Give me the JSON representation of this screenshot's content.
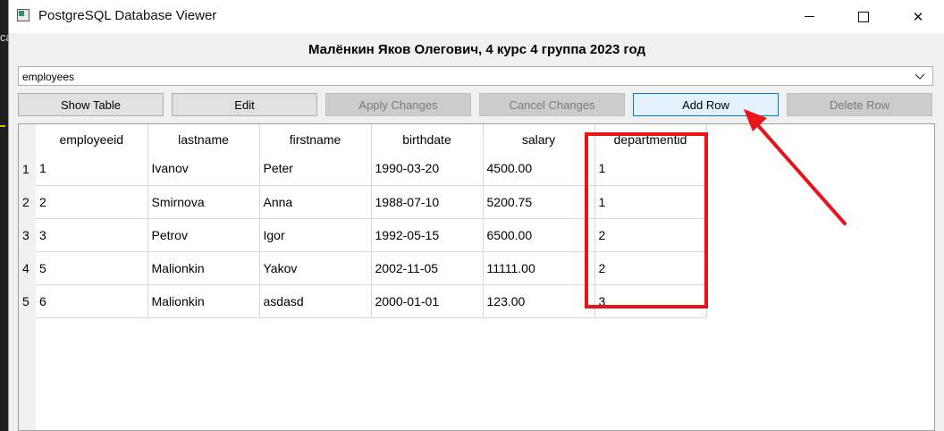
{
  "window": {
    "title": "PostgreSQL Database Viewer"
  },
  "background_edge_text": "ca",
  "header": {
    "label": "Малёнкин Яков Олегович, 4 курс 4 группа 2023 год"
  },
  "table_select": {
    "selected": "employees"
  },
  "toolbar": {
    "show_table": "Show Table",
    "edit": "Edit",
    "apply_changes": "Apply Changes",
    "cancel_changes": "Cancel Changes",
    "add_row": "Add Row",
    "delete_row": "Delete Row"
  },
  "table": {
    "columns": [
      "employeeid",
      "lastname",
      "firstname",
      "birthdate",
      "salary",
      "departmentid"
    ],
    "rows": [
      {
        "num": "1",
        "cells": [
          "1",
          "Ivanov",
          "Peter",
          "1990-03-20",
          "4500.00",
          "1"
        ]
      },
      {
        "num": "2",
        "cells": [
          "2",
          "Smirnova",
          "Anna",
          "1988-07-10",
          "5200.75",
          "1"
        ]
      },
      {
        "num": "3",
        "cells": [
          "3",
          "Petrov",
          "Igor",
          "1992-05-15",
          "6500.00",
          "2"
        ]
      },
      {
        "num": "4",
        "cells": [
          "5",
          "Malionkin",
          "Yakov",
          "2002-11-05",
          "11111.00",
          "2"
        ]
      },
      {
        "num": "5",
        "cells": [
          "6",
          "Malionkin",
          "asdasd",
          "2000-01-01",
          "123.00",
          "3"
        ]
      }
    ]
  },
  "annotation": {
    "color": "#e8141a"
  }
}
